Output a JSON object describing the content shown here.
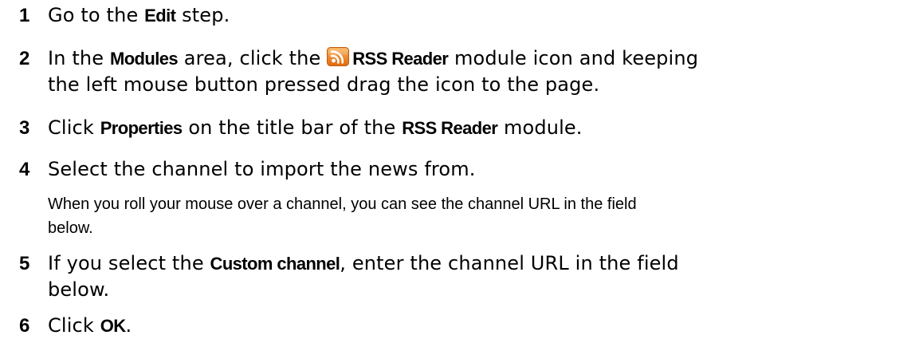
{
  "steps": [
    {
      "num": "1",
      "a": "Go to the ",
      "b": "Edit",
      "c": " step."
    },
    {
      "num": "2",
      "a": "In the ",
      "b": "Modules",
      "c": " area, click the ",
      "d": "RSS Reader",
      "e": " module icon and keeping",
      "f": "the left mouse button pressed drag the icon to the page."
    },
    {
      "num": "3",
      "a": "Click ",
      "b": "Properties",
      "c": " on the title bar of the ",
      "d": "RSS Reader",
      "e": " module."
    },
    {
      "num": "4",
      "a": "Select the channel to import the news from."
    },
    {
      "num": "5",
      "a": "If you select the ",
      "b": "Custom channel",
      "c": ", enter the channel URL in the field",
      "f": "below."
    },
    {
      "num": "6",
      "a": "Click ",
      "b": "OK",
      "c": "."
    }
  ],
  "note": {
    "line1": "When you roll your mouse over a channel, you can see the channel URL in the field",
    "line2": "below."
  },
  "icons": {
    "rss": "rss-feed-icon"
  },
  "colors": {
    "rss_orange": "#F08A24"
  }
}
